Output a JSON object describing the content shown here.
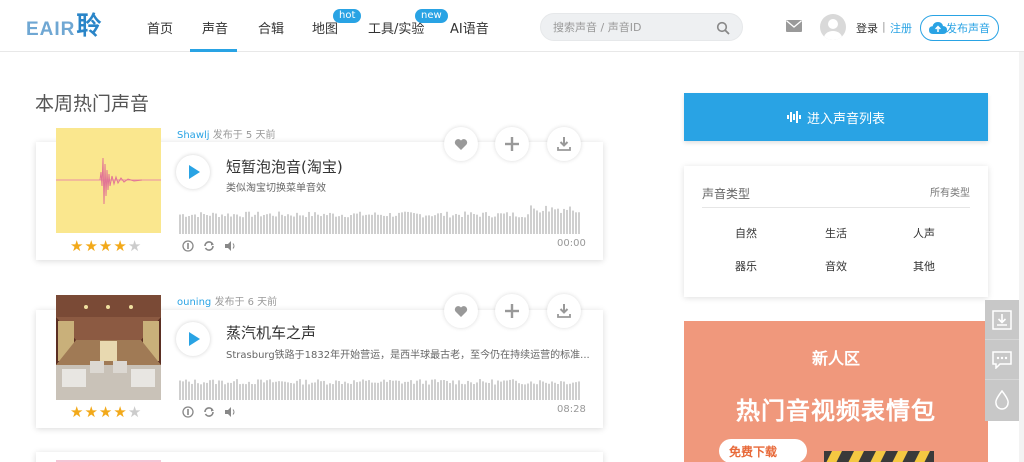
{
  "header": {
    "logo_main": "EAIR",
    "logo_char": "聆",
    "nav": [
      {
        "label": "首页"
      },
      {
        "label": "声音"
      },
      {
        "label": "合辑"
      },
      {
        "label": "地图",
        "badge": "hot"
      },
      {
        "label": "工具/实验",
        "badge": "new"
      },
      {
        "label": "AI语音"
      }
    ],
    "search_placeholder": "搜索声音 / 声音ID",
    "login": "登录",
    "separator": "|",
    "register": "注册",
    "publish": "发布声音"
  },
  "section_title": "本周热门声音",
  "sounds": [
    {
      "user": "Shawlj",
      "posted": " 发布于 5 天前",
      "title": "短暂泡泡音(淘宝)",
      "desc": "类似淘宝切换菜单音效",
      "time": "00:00",
      "stars": 4,
      "stars_max": 5
    },
    {
      "user": "ouning",
      "posted": " 发布于 6 天前",
      "title": "蒸汽机车之声",
      "desc": "Strasburg铁路于1832年开始营运，是西半球最古老，至今仍在持续运营的标准...",
      "time": "08:28",
      "stars": 4,
      "stars_max": 5
    }
  ],
  "star_glyph": "★",
  "sidebar": {
    "enter_list": "进入声音列表",
    "types_title": "声音类型",
    "types_all": "所有类型",
    "types": [
      "自然",
      "生活",
      "人声",
      "器乐",
      "音效",
      "其他"
    ]
  },
  "banner": {
    "newbie": "新人区",
    "headline": "热门音视频表情包",
    "button": "免费下载"
  },
  "colors": {
    "accent": "#29a3e4",
    "star": "#f2a91a",
    "banner": "#f0987c"
  }
}
